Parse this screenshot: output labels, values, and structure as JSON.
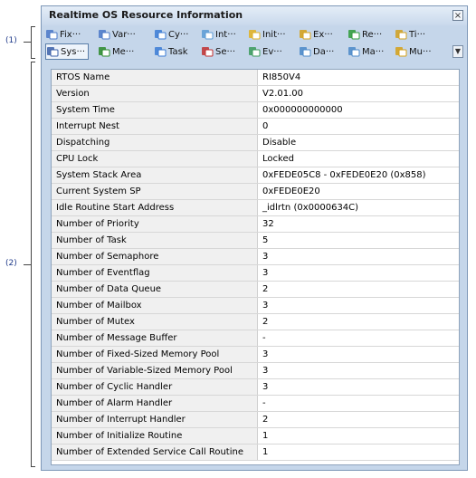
{
  "callouts": {
    "toolbar": "(1)",
    "grid": "(2)"
  },
  "window": {
    "title": "Realtime OS Resource Information",
    "close_label": "×"
  },
  "toolbar_row1": [
    {
      "label": "Fix···",
      "icon": "fixed-pool-icon",
      "color": "#4a78c8"
    },
    {
      "label": "Var···",
      "icon": "variable-pool-icon",
      "color": "#4a78c8"
    },
    {
      "label": "Cy···",
      "icon": "cyclic-handler-icon",
      "color": "#3a7bd5"
    },
    {
      "label": "Int···",
      "icon": "interrupt-handler-icon",
      "color": "#5b9bd5"
    },
    {
      "label": "Init···",
      "icon": "initialize-routine-icon",
      "color": "#e0b020"
    },
    {
      "label": "Ex···",
      "icon": "extended-service-icon",
      "color": "#d4a017"
    },
    {
      "label": "Re···",
      "icon": "ready-queue-icon",
      "color": "#2e9b3a"
    },
    {
      "label": "Ti···",
      "icon": "timer-queue-icon",
      "color": "#d0a020"
    }
  ],
  "toolbar_row2": [
    {
      "label": "Sys···",
      "icon": "system-icon",
      "color": "#3a5fa8",
      "active": true
    },
    {
      "label": "Me···",
      "icon": "memory-icon",
      "color": "#2a8a2a"
    },
    {
      "label": "Task",
      "icon": "task-icon",
      "color": "#3a7bd5"
    },
    {
      "label": "Se···",
      "icon": "semaphore-icon",
      "color": "#c03030"
    },
    {
      "label": "Ev···",
      "icon": "eventflag-icon",
      "color": "#3a9a5a"
    },
    {
      "label": "Da···",
      "icon": "data-queue-icon",
      "color": "#4a88c8"
    },
    {
      "label": "Ma···",
      "icon": "mailbox-icon",
      "color": "#4a88c8"
    },
    {
      "label": "Mu···",
      "icon": "mutex-icon",
      "color": "#d4a017"
    }
  ],
  "rows": [
    {
      "name": "RTOS Name",
      "value": "RI850V4"
    },
    {
      "name": "Version",
      "value": "V2.01.00"
    },
    {
      "name": "System Time",
      "value": "0x000000000000"
    },
    {
      "name": "Interrupt Nest",
      "value": "0"
    },
    {
      "name": "Dispatching",
      "value": "Disable"
    },
    {
      "name": "CPU Lock",
      "value": "Locked"
    },
    {
      "name": "System Stack Area",
      "value": "0xFEDE05C8 - 0xFEDE0E20 (0x858)"
    },
    {
      "name": "Current System SP",
      "value": "0xFEDE0E20"
    },
    {
      "name": "Idle Routine Start Address",
      "value": "_idlrtn (0x0000634C)"
    },
    {
      "name": "Number of Priority",
      "value": "32"
    },
    {
      "name": "Number of Task",
      "value": "5"
    },
    {
      "name": "Number of Semaphore",
      "value": "3"
    },
    {
      "name": "Number of Eventflag",
      "value": "3"
    },
    {
      "name": "Number of Data Queue",
      "value": "2"
    },
    {
      "name": "Number of Mailbox",
      "value": "3"
    },
    {
      "name": "Number of Mutex",
      "value": "2"
    },
    {
      "name": "Number of Message Buffer",
      "value": "-"
    },
    {
      "name": "Number of Fixed-Sized Memory Pool",
      "value": "3"
    },
    {
      "name": "Number of Variable-Sized Memory Pool",
      "value": "3"
    },
    {
      "name": "Number of Cyclic Handler",
      "value": "3"
    },
    {
      "name": "Number of Alarm Handler",
      "value": "-"
    },
    {
      "name": "Number of Interrupt Handler",
      "value": "2"
    },
    {
      "name": "Number of Initialize Routine",
      "value": "1"
    },
    {
      "name": "Number of Extended Service Call Routine",
      "value": "1"
    }
  ]
}
